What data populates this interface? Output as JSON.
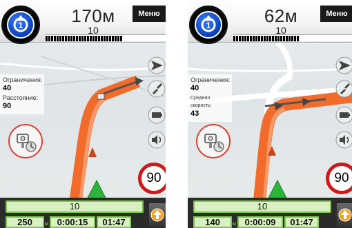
{
  "screens": [
    {
      "distance": "170м",
      "street_number": "10",
      "route_progress": 0.64,
      "menu_label": "Меню",
      "info": [
        {
          "label": "Ограничения:",
          "value": "40"
        },
        {
          "label": "Расстояние:",
          "value": "90"
        }
      ],
      "speed_limit": "90",
      "bottom": {
        "street": "10",
        "distance": "250",
        "time_remaining": "0:00:15",
        "arrival_time": "01:47"
      }
    },
    {
      "distance": "62м",
      "street_number": "10",
      "route_progress": 0.55,
      "menu_label": "Меню",
      "info": [
        {
          "label": "Ограничения:",
          "value": "40"
        },
        {
          "label": "Средняя скорость:",
          "value": "43"
        }
      ],
      "speed_limit": "90",
      "bottom": {
        "street": "10",
        "distance": "140",
        "time_remaining": "0:00:09",
        "arrival_time": "01:47"
      }
    }
  ],
  "icons": {
    "turn": "roundabout-icon",
    "compass": "compass-arrow-icon",
    "zoom": "zoom-arrows-icon",
    "battery": "battery-icon",
    "volume": "volume-icon",
    "camera": "speed-camera-icon",
    "up": "up-arrow-icon"
  },
  "colors": {
    "route": "#f26b2b",
    "turn_blue": "#1046c8",
    "field_green": "#d9f1c2",
    "field_border": "#7cc64a",
    "speed_red": "#d01818",
    "position_arrow": "#29b63a"
  }
}
